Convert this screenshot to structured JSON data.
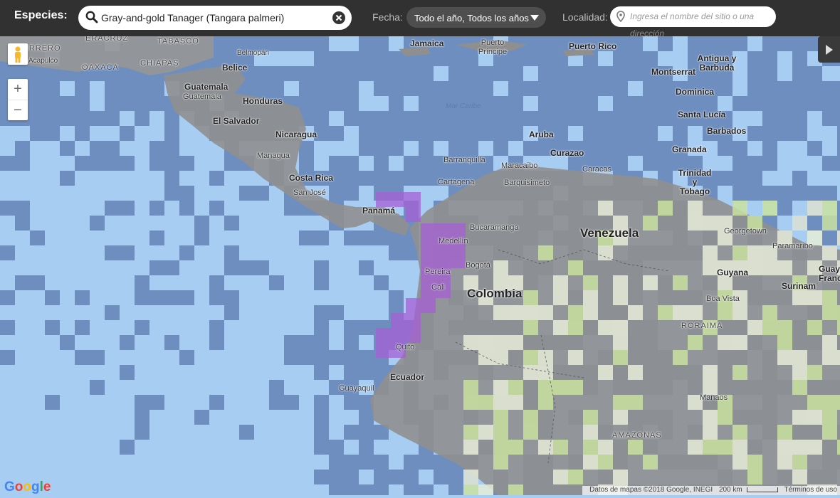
{
  "topbar": {
    "species_label": "Especies:",
    "species_value": "Gray-and-gold Tanager (Tangara palmeri)",
    "date_label": "Fecha:",
    "date_value": "Todo el año, Todos los años",
    "location_label": "Localidad:",
    "location_placeholder": "Ingresa el nombre del sitio o una",
    "location_placeholder_overflow": "dirección"
  },
  "map": {
    "countries": [
      "Belice",
      "Guatemala",
      "Honduras",
      "El Salvador",
      "Nicaragua",
      "Costa Rica",
      "Panamá",
      "Colombia",
      "Venezuela",
      "Ecuador",
      "Guyana",
      "Surinam",
      "Puerto Príncipe",
      "Puerto Rico",
      "Jamaica",
      "Antigua y Barbuda",
      "Montserrat",
      "Dominica",
      "Santa Lucía",
      "Barbados",
      "Granada",
      "Trinidad y Tobago",
      "Aruba",
      "Curazao",
      "Guay Franc"
    ],
    "cities": [
      "Acapulco",
      "Belmopán",
      "Guatemala",
      "Managua",
      "San José",
      "Barranquilla",
      "Cartagena",
      "Maracaibo",
      "Barquisimeto",
      "Caracas",
      "Bucaramanga",
      "Medellín",
      "Pereira",
      "Bogotá",
      "Cali",
      "Quito",
      "Guayaquil",
      "Georgetown",
      "Paramaribo",
      "Boa Vista",
      "Manaos"
    ],
    "regions": [
      "GUERRERO",
      "OAXACA",
      "CHIAPAS",
      "TABASCO",
      "AMAZONAS",
      "RORAIMA",
      "ERACRUZ"
    ],
    "water": [
      "Mar Caribe"
    ],
    "grid_color": "#5b78ad",
    "presence_color": "#a65fd6"
  },
  "controls": {
    "zoom_in": "+",
    "zoom_out": "−"
  },
  "footer": {
    "logo": "Google",
    "attribution": "Datos de mapas ©2018 Google, INEGI",
    "scale": "200 km",
    "terms": "Términos de uso"
  }
}
